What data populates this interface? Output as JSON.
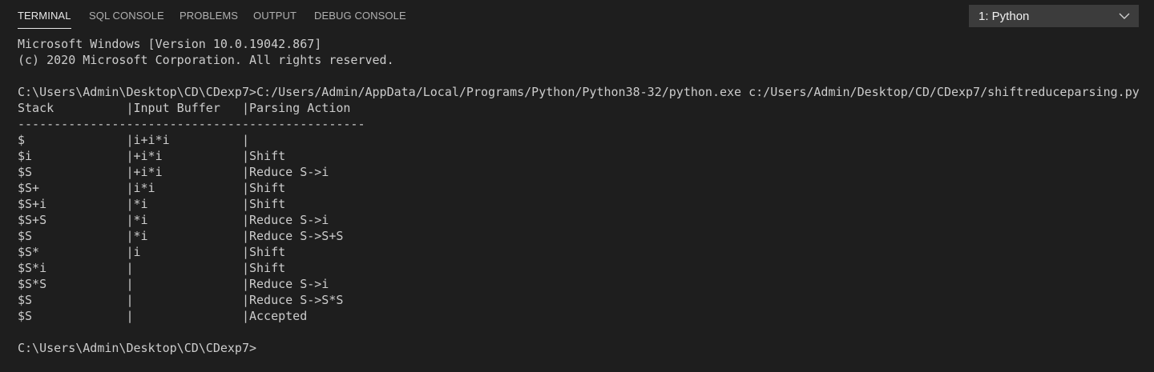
{
  "tabs": [
    {
      "label": "TERMINAL",
      "active": true
    },
    {
      "label": "SQL CONSOLE",
      "active": false
    },
    {
      "label": "PROBLEMS",
      "active": false
    },
    {
      "label": "OUTPUT",
      "active": false
    },
    {
      "label": "DEBUG CONSOLE",
      "active": false
    }
  ],
  "terminal_selector": {
    "value": "1: Python",
    "icon": "chevron-down-icon"
  },
  "terminal": {
    "lines": [
      "Microsoft Windows [Version 10.0.19042.867]",
      "(c) 2020 Microsoft Corporation. All rights reserved.",
      "",
      "C:\\Users\\Admin\\Desktop\\CD\\CDexp7>C:/Users/Admin/AppData/Local/Programs/Python/Python38-32/python.exe c:/Users/Admin/Desktop/CD/CDexp7/shiftreduceparsing.py",
      "Stack          |Input Buffer   |Parsing Action",
      "------------------------------------------------",
      "$              |i+i*i          |",
      "$i             |+i*i           |Shift",
      "$S             |+i*i           |Reduce S->i",
      "$S+            |i*i            |Shift",
      "$S+i           |*i             |Shift",
      "$S+S           |*i             |Reduce S->i",
      "$S             |*i             |Reduce S->S+S",
      "$S*            |i              |Shift",
      "$S*i           |               |Shift",
      "$S*S           |               |Reduce S->i",
      "$S             |               |Reduce S->S*S",
      "$S             |               |Accepted",
      "",
      "C:\\Users\\Admin\\Desktop\\CD\\CDexp7>"
    ]
  },
  "colors": {
    "background": "#1e1e1e",
    "text": "#cccccc",
    "tab_active": "#e7e7e7",
    "tab_inactive": "#b0b0b0",
    "dropdown_bg": "#3c3c3c"
  }
}
